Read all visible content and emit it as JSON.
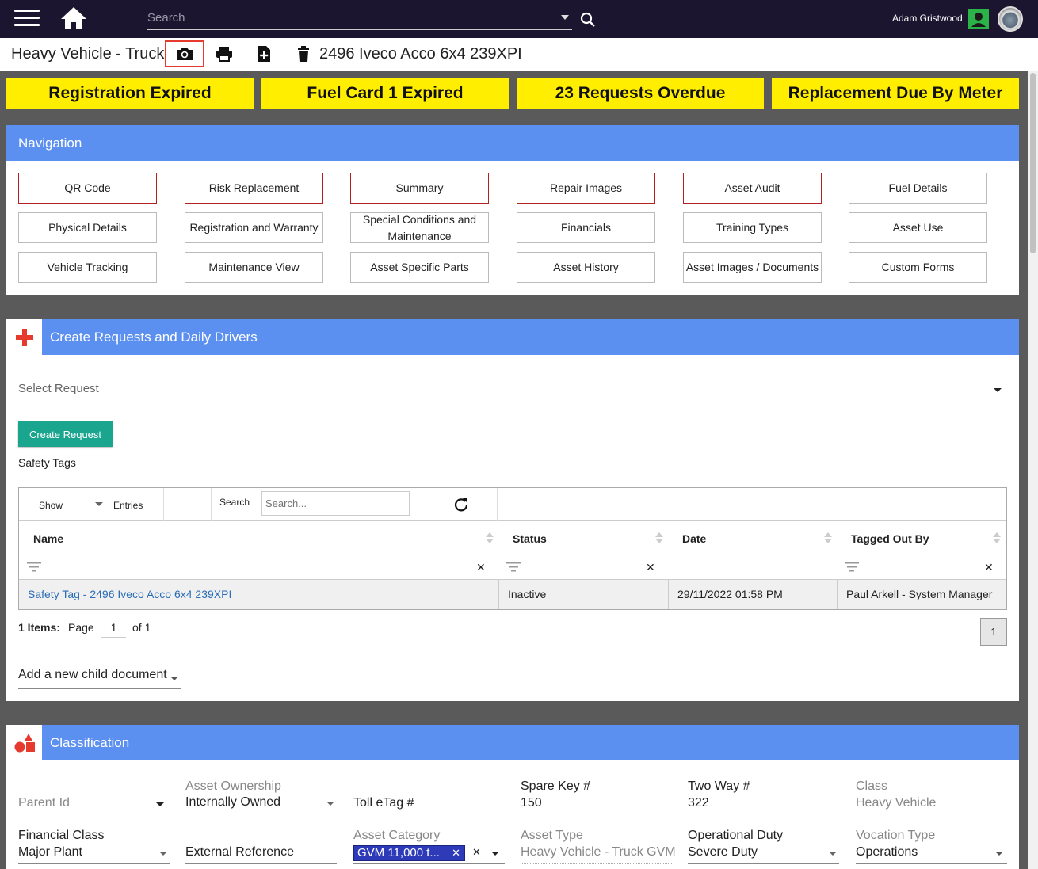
{
  "topbar": {
    "search_placeholder": "Search",
    "user_name": "Adam Gristwood"
  },
  "titlebar": {
    "page_title": "Heavy Vehicle - Truck",
    "asset_title": "2496 Iveco Acco 6x4 239XPI"
  },
  "alerts": [
    "Registration Expired",
    "Fuel Card 1 Expired",
    "23 Requests Overdue",
    "Replacement Due By Meter"
  ],
  "navigation": {
    "title": "Navigation",
    "items": [
      "QR Code",
      "Risk Replacement",
      "Summary",
      "Repair Images",
      "Asset Audit",
      "Fuel Details",
      "Physical Details",
      "Registration and Warranty",
      "Special Conditions and Maintenance",
      "Financials",
      "Training Types",
      "Asset Use",
      "Vehicle Tracking",
      "Maintenance View",
      "Asset Specific Parts",
      "Asset History",
      "Asset Images / Documents",
      "Custom Forms"
    ]
  },
  "requests": {
    "title": "Create Requests and Daily Drivers",
    "select_placeholder": "Select Request",
    "create_button": "Create Request",
    "safety_tags_label": "Safety Tags",
    "grid": {
      "show_label": "Show",
      "entries_label": "Entries",
      "search_label": "Search",
      "search_placeholder": "Search...",
      "columns": [
        "Name",
        "Status",
        "Date",
        "Tagged Out By"
      ],
      "rows": [
        {
          "name": "Safety Tag - 2496 Iveco Acco 6x4 239XPI",
          "status": "Inactive",
          "date": "29/11/2022 01:58 PM",
          "tagged_out_by": "Paul Arkell - System Manager"
        }
      ]
    },
    "pager": {
      "items_label": "1 Items:",
      "page_label": "Page",
      "page_value": "1",
      "of_label": "of 1",
      "page_button": "1"
    },
    "child_document": "Add a new child document"
  },
  "classification": {
    "title": "Classification",
    "fields": {
      "parent_id": {
        "label": "Parent Id",
        "value": ""
      },
      "asset_ownership": {
        "label": "Asset Ownership",
        "value": "Internally Owned"
      },
      "toll_etag": {
        "label": "Toll eTag #",
        "value": ""
      },
      "spare_key": {
        "label": "Spare Key #",
        "value": "150"
      },
      "two_way": {
        "label": "Two Way #",
        "value": "322"
      },
      "class": {
        "label": "Class",
        "value": "Heavy Vehicle"
      },
      "financial_class": {
        "label": "Financial Class",
        "value": "Major Plant"
      },
      "external_reference": {
        "label": "External Reference",
        "value": ""
      },
      "asset_category": {
        "label": "Asset Category",
        "value": "GVM 11,000 t..."
      },
      "asset_type": {
        "label": "Asset Type",
        "value": "Heavy Vehicle - Truck GVM"
      },
      "operational_duty": {
        "label": "Operational Duty",
        "value": "Severe Duty"
      },
      "vocation_type": {
        "label": "Vocation Type",
        "value": "Operations"
      }
    }
  },
  "colors": {
    "topbar": "#1b1530",
    "panel_header": "#5b8ff0",
    "alert": "#ffee00",
    "create_button": "#1aa58f",
    "icon_red": "#e63a2e"
  }
}
